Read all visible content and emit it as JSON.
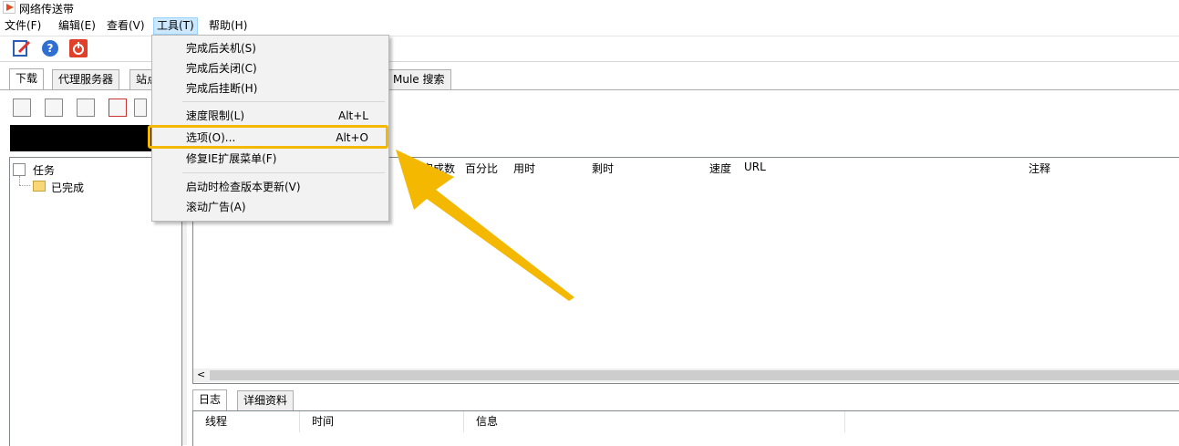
{
  "window": {
    "title": "网络传送带"
  },
  "menubar": {
    "items": [
      "文件(F)",
      "编辑(E)",
      "查看(V)",
      "工具(T)",
      "帮助(H)"
    ]
  },
  "tabs": {
    "download": "下载",
    "proxy": "代理服务器",
    "site": "站点",
    "emule": "Mule 搜索"
  },
  "tree": {
    "root": "任务",
    "child": "已完成"
  },
  "list_columns": {
    "done": "完成数",
    "percent": "百分比",
    "used": "用时",
    "remaining": "剩时",
    "speed": "速度",
    "url": "URL",
    "note": "注释"
  },
  "bottom_tabs": {
    "log": "日志",
    "details": "详细资料"
  },
  "log_columns": {
    "thread": "线程",
    "time": "时间",
    "info": "信息"
  },
  "scroll": {
    "left_arrow": "<"
  },
  "tools_menu": {
    "items": [
      {
        "label": "完成后关机(S)",
        "shortcut": ""
      },
      {
        "label": "完成后关闭(C)",
        "shortcut": ""
      },
      {
        "label": "完成后挂断(H)",
        "shortcut": ""
      },
      {
        "label": "速度限制(L)",
        "shortcut": "Alt+L"
      },
      {
        "label": "选项(O)...",
        "shortcut": "Alt+O"
      },
      {
        "label": "修复IE扩展菜单(F)",
        "shortcut": ""
      },
      {
        "label": "启动时检查版本更新(V)",
        "shortcut": ""
      },
      {
        "label": "滚动广告(A)",
        "shortcut": ""
      }
    ],
    "highlighted": "选项(O)..."
  },
  "colors": {
    "highlight": "#f5b800",
    "menu_active": "#cce8ff",
    "accent_red": "#e24b1c"
  }
}
